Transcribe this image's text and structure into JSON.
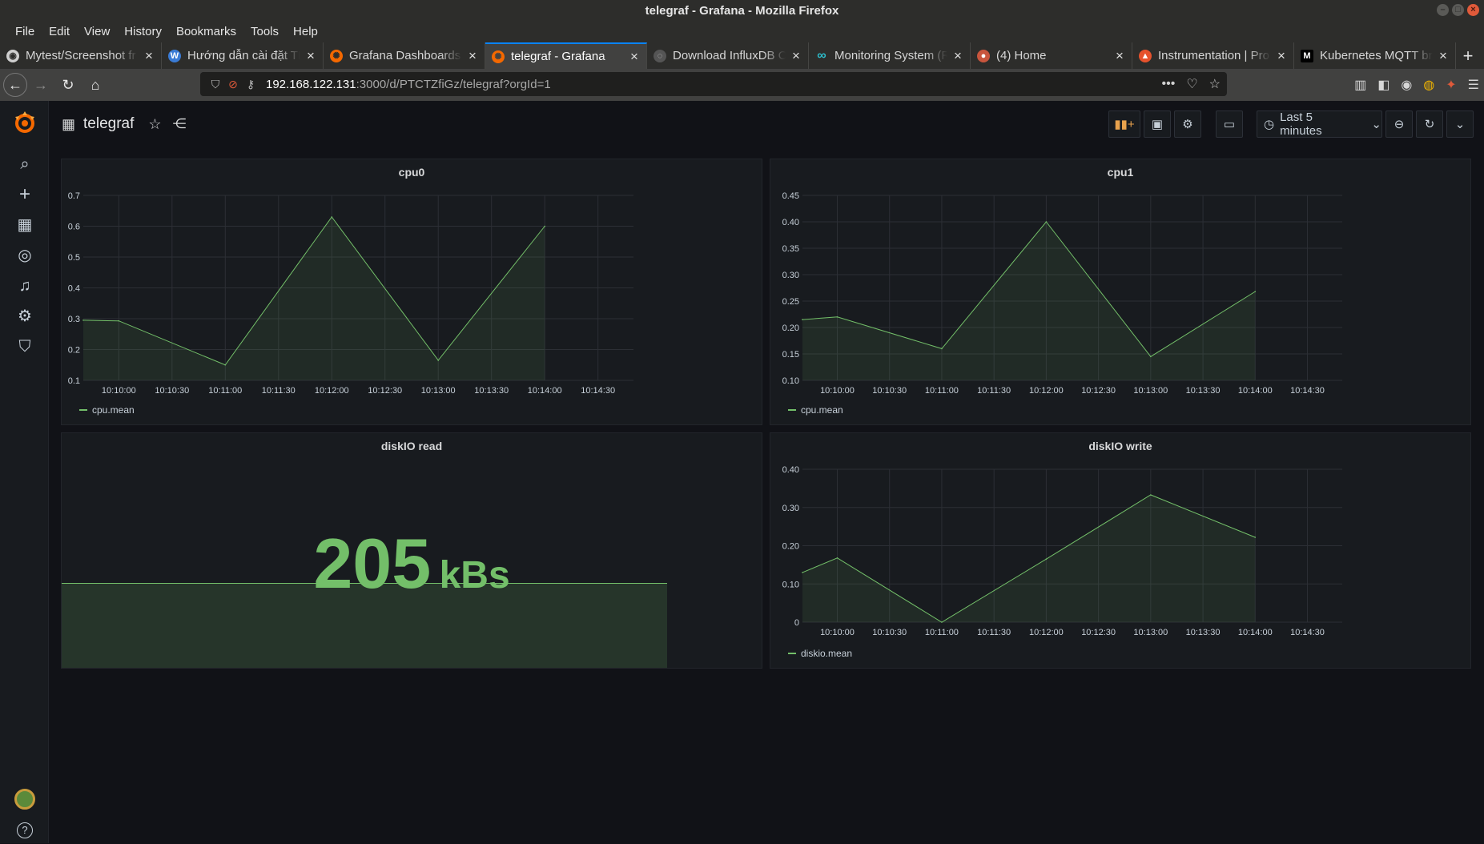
{
  "window": {
    "title": "telegraf - Grafana - Mozilla Firefox"
  },
  "menu": [
    "File",
    "Edit",
    "View",
    "History",
    "Bookmarks",
    "Tools",
    "Help"
  ],
  "tabs": [
    {
      "title": "Mytest/Screenshot fr",
      "icon": "github-icon",
      "icon_color": "#2d2d2b",
      "active": false
    },
    {
      "title": "Hướng dẫn cài đặt TIG",
      "icon": "wordpress-icon",
      "icon_color": "#3a7bd5",
      "active": false
    },
    {
      "title": "Grafana Dashboards - ",
      "icon": "grafana-icon",
      "icon_color": "#f46800",
      "active": false
    },
    {
      "title": "telegraf - Grafana",
      "icon": "grafana-icon",
      "icon_color": "#f46800",
      "active": true
    },
    {
      "title": "Download InfluxDB O",
      "icon": "influxdb-icon",
      "icon_color": "#222222",
      "active": false
    },
    {
      "title": "Monitoring System (R",
      "icon": "infinity-icon",
      "icon_color": "#2dbecd",
      "active": false
    },
    {
      "title": "(4) Home",
      "icon": "home-site-icon",
      "icon_color": "#c8553d",
      "active": false
    },
    {
      "title": "Instrumentation | Pro",
      "icon": "prometheus-icon",
      "icon_color": "#e6522c",
      "active": false
    },
    {
      "title": "Kubernetes MQTT br",
      "icon": "medium-icon",
      "icon_color": "#000000",
      "active": false
    }
  ],
  "url": {
    "host": "192.168.122.131",
    "path": ":3000/d/PTCTZfiGz/telegraf?orgId=1"
  },
  "dashboard": {
    "title": "telegraf",
    "time_range": "Last 5 minutes"
  },
  "colors": {
    "series": "#73bf69",
    "panel_bg": "#181b1f",
    "page_bg": "#111217"
  },
  "panels": {
    "cpu0": {
      "title": "cpu0",
      "legend": "cpu.mean"
    },
    "cpu1": {
      "title": "cpu1",
      "legend": "cpu.mean"
    },
    "diskio_read": {
      "title": "diskIO read",
      "value": "205",
      "unit": "kBs",
      "fill": 0.36
    },
    "diskio_write": {
      "title": "diskIO write",
      "legend": "diskio.mean"
    }
  },
  "chart_data": [
    {
      "type": "area",
      "title": "cpu0",
      "x": [
        "10:09:40",
        "10:10:00",
        "10:11:00",
        "10:12:00",
        "10:13:00",
        "10:14:00"
      ],
      "series": [
        {
          "name": "cpu.mean",
          "values": [
            0.295,
            0.293,
            0.15,
            0.63,
            0.165,
            0.6
          ]
        }
      ],
      "xticks": [
        "10:10:00",
        "10:10:30",
        "10:11:00",
        "10:11:30",
        "10:12:00",
        "10:12:30",
        "10:13:00",
        "10:13:30",
        "10:14:00",
        "10:14:30"
      ],
      "yticks": [
        "0.1",
        "0.2",
        "0.3",
        "0.4",
        "0.5",
        "0.6",
        "0.7"
      ],
      "ylim": [
        0.1,
        0.7
      ],
      "grid": true,
      "legend": "bottom-left"
    },
    {
      "type": "area",
      "title": "cpu1",
      "x": [
        "10:09:40",
        "10:10:00",
        "10:11:00",
        "10:12:00",
        "10:13:00",
        "10:14:00"
      ],
      "series": [
        {
          "name": "cpu.mean",
          "values": [
            0.215,
            0.22,
            0.16,
            0.4,
            0.145,
            0.268
          ]
        }
      ],
      "xticks": [
        "10:10:00",
        "10:10:30",
        "10:11:00",
        "10:11:30",
        "10:12:00",
        "10:12:30",
        "10:13:00",
        "10:13:30",
        "10:14:00",
        "10:14:30"
      ],
      "yticks": [
        "0.10",
        "0.15",
        "0.20",
        "0.25",
        "0.30",
        "0.35",
        "0.40",
        "0.45"
      ],
      "ylim": [
        0.1,
        0.45
      ],
      "grid": true,
      "legend": "bottom-left"
    },
    {
      "type": "area",
      "title": "diskIO write",
      "x": [
        "10:09:40",
        "10:10:00",
        "10:11:00",
        "10:12:00",
        "10:13:00",
        "10:14:00"
      ],
      "series": [
        {
          "name": "diskio.mean",
          "values": [
            0.13,
            0.168,
            0.0,
            0.165,
            0.333,
            0.222
          ]
        }
      ],
      "xticks": [
        "10:10:00",
        "10:10:30",
        "10:11:00",
        "10:11:30",
        "10:12:00",
        "10:12:30",
        "10:13:00",
        "10:13:30",
        "10:14:00",
        "10:14:30"
      ],
      "yticks": [
        "0",
        "0.10",
        "0.20",
        "0.30",
        "0.40"
      ],
      "ylim": [
        0,
        0.4
      ],
      "grid": true,
      "legend": "bottom-left"
    }
  ]
}
